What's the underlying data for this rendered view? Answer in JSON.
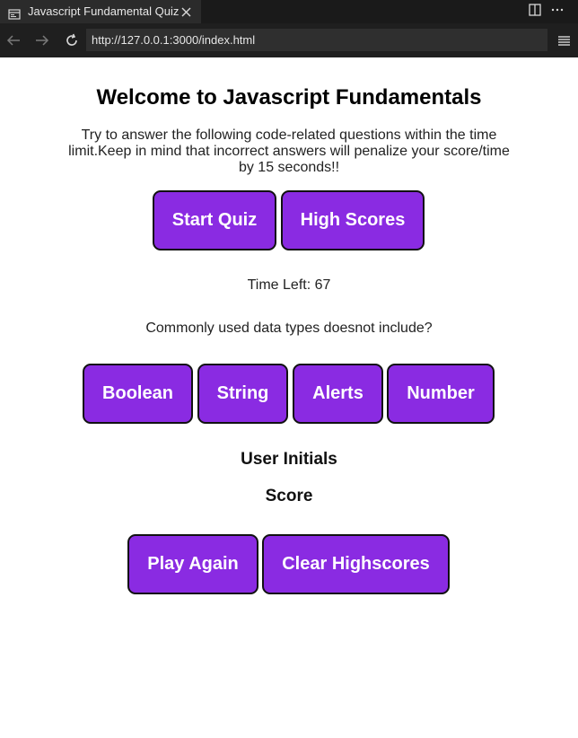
{
  "browser": {
    "tab_title": "Javascript Fundamental Quiz",
    "url": "http://127.0.0.1:3000/index.html",
    "icons": {
      "favicon": "page-icon",
      "tab_close": "close-icon",
      "split": "split-view-icon",
      "more": "more-icon",
      "back": "back-arrow-icon",
      "forward": "forward-arrow-icon",
      "reload": "reload-icon",
      "menu": "hamburger-menu-icon"
    }
  },
  "page": {
    "title": "Welcome to Javascript Fundamentals",
    "intro": "Try to answer the following code-related questions within the time limit.Keep in mind that incorrect answers will penalize your score/time by 15 seconds!!",
    "start_button": "Start Quiz",
    "high_scores_button": "High Scores",
    "timer": "Time Left: 67",
    "question": "Commonly used data types doesnot include?",
    "answers": [
      "Boolean",
      "String",
      "Alerts",
      "Number"
    ],
    "user_initials_label": "User Initials",
    "score_label": "Score",
    "play_again_button": "Play Again",
    "clear_highscores_button": "Clear Highscores"
  },
  "colors": {
    "button_bg": "#8a2be2",
    "button_text": "#ffffff",
    "button_border": "#111111",
    "chrome_bg": "#1f1f1f"
  }
}
